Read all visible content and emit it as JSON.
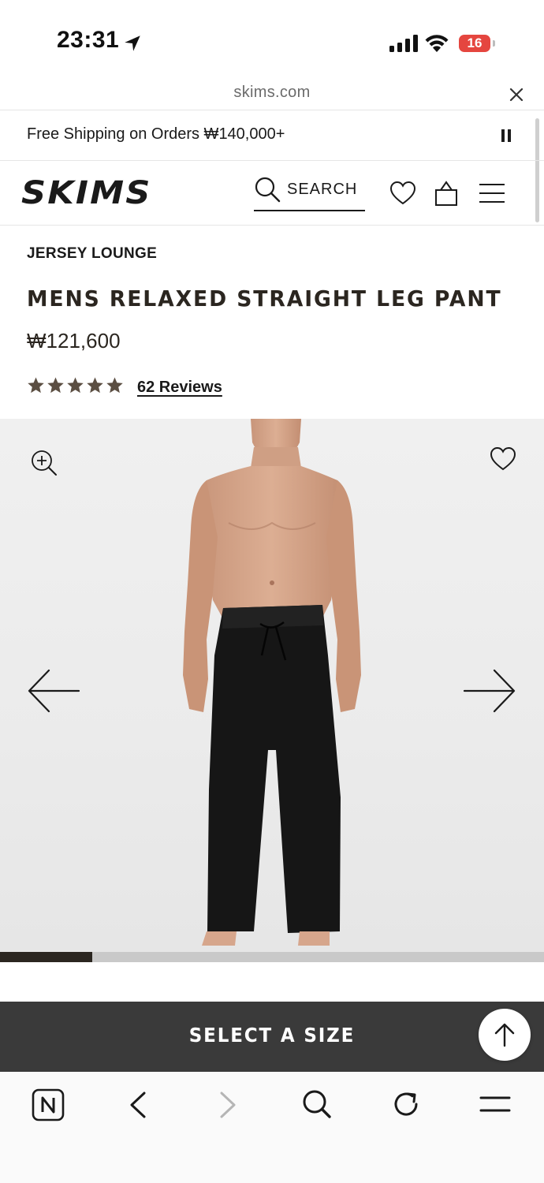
{
  "status_bar": {
    "time": "23:31",
    "battery_level": "16"
  },
  "browser": {
    "url": "skims.com"
  },
  "promo_banner": {
    "text": "Free Shipping on Orders ₩140,000+"
  },
  "header": {
    "logo": "SKIMS",
    "search_label": "SEARCH"
  },
  "product": {
    "collection": "JERSEY LOUNGE",
    "title": "MENS RELAXED STRAIGHT LEG PANT",
    "price": "₩121,600",
    "rating": 5,
    "reviews_label": "62 Reviews",
    "gallery_progress": 0.17
  },
  "cta": {
    "label": "SELECT A SIZE"
  },
  "colors": {
    "star": "#5b4e42",
    "cta_background": "#3a3a3a",
    "battery": "#e5463f",
    "progress": "#2b2620"
  },
  "icons": [
    "location-arrow-icon",
    "signal-icon",
    "wifi-icon",
    "battery-icon",
    "close-icon",
    "pause-icon",
    "search-icon",
    "heart-icon",
    "bag-icon",
    "menu-icon",
    "star-icon",
    "zoom-in-icon",
    "prev-arrow-icon",
    "next-arrow-icon",
    "arrow-up-icon",
    "notion-icon",
    "back-icon",
    "forward-icon",
    "reload-icon"
  ]
}
